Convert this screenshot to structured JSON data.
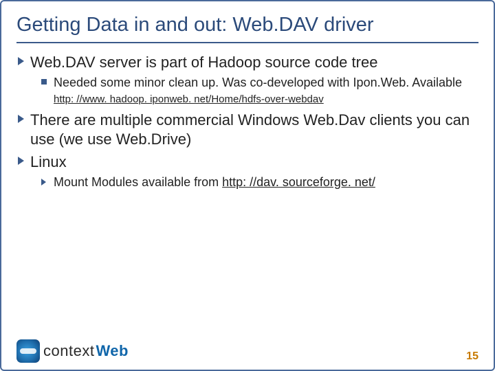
{
  "title": "Getting Data in and out: Web.DAV driver",
  "bullets": {
    "b1": "Web.DAV server is part of Hadoop source code tree",
    "b1a_part1": "Needed some minor clean up. Was co-developed with Ipon.Web. Available ",
    "b1a_link": "http: //www. hadoop. iponweb. net/Home/hdfs-over-webdav",
    "b2": "There are multiple commercial Windows Web.Dav clients you can use (we use Web.Drive)",
    "b3": "Linux",
    "b3a_part1": "Mount Modules available from ",
    "b3a_link": "http: //dav. sourceforge. net/"
  },
  "logo": {
    "word1": "context",
    "word2": "Web"
  },
  "page_number": "15"
}
